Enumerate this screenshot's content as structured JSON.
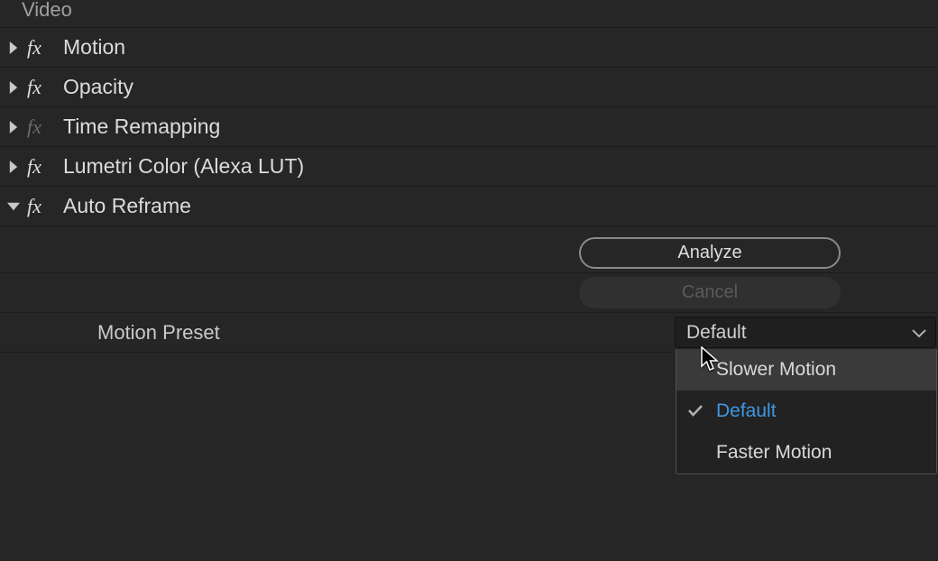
{
  "video_section_label": "Video",
  "fx_label": "fx",
  "effects": [
    {
      "name": "Motion",
      "expanded": false,
      "dim": false
    },
    {
      "name": "Opacity",
      "expanded": false,
      "dim": false
    },
    {
      "name": "Time Remapping",
      "expanded": false,
      "dim": true
    },
    {
      "name": "Lumetri Color (Alexa LUT)",
      "expanded": false,
      "dim": false
    },
    {
      "name": "Auto Reframe",
      "expanded": true,
      "dim": false
    }
  ],
  "auto_reframe": {
    "analyze_label": "Analyze",
    "cancel_label": "Cancel",
    "motion_preset_label": "Motion Preset",
    "selected_preset": "Default",
    "options": [
      {
        "label": "Slower Motion",
        "selected": false,
        "hovered": true
      },
      {
        "label": "Default",
        "selected": true,
        "hovered": false
      },
      {
        "label": "Faster Motion",
        "selected": false,
        "hovered": false
      }
    ]
  }
}
